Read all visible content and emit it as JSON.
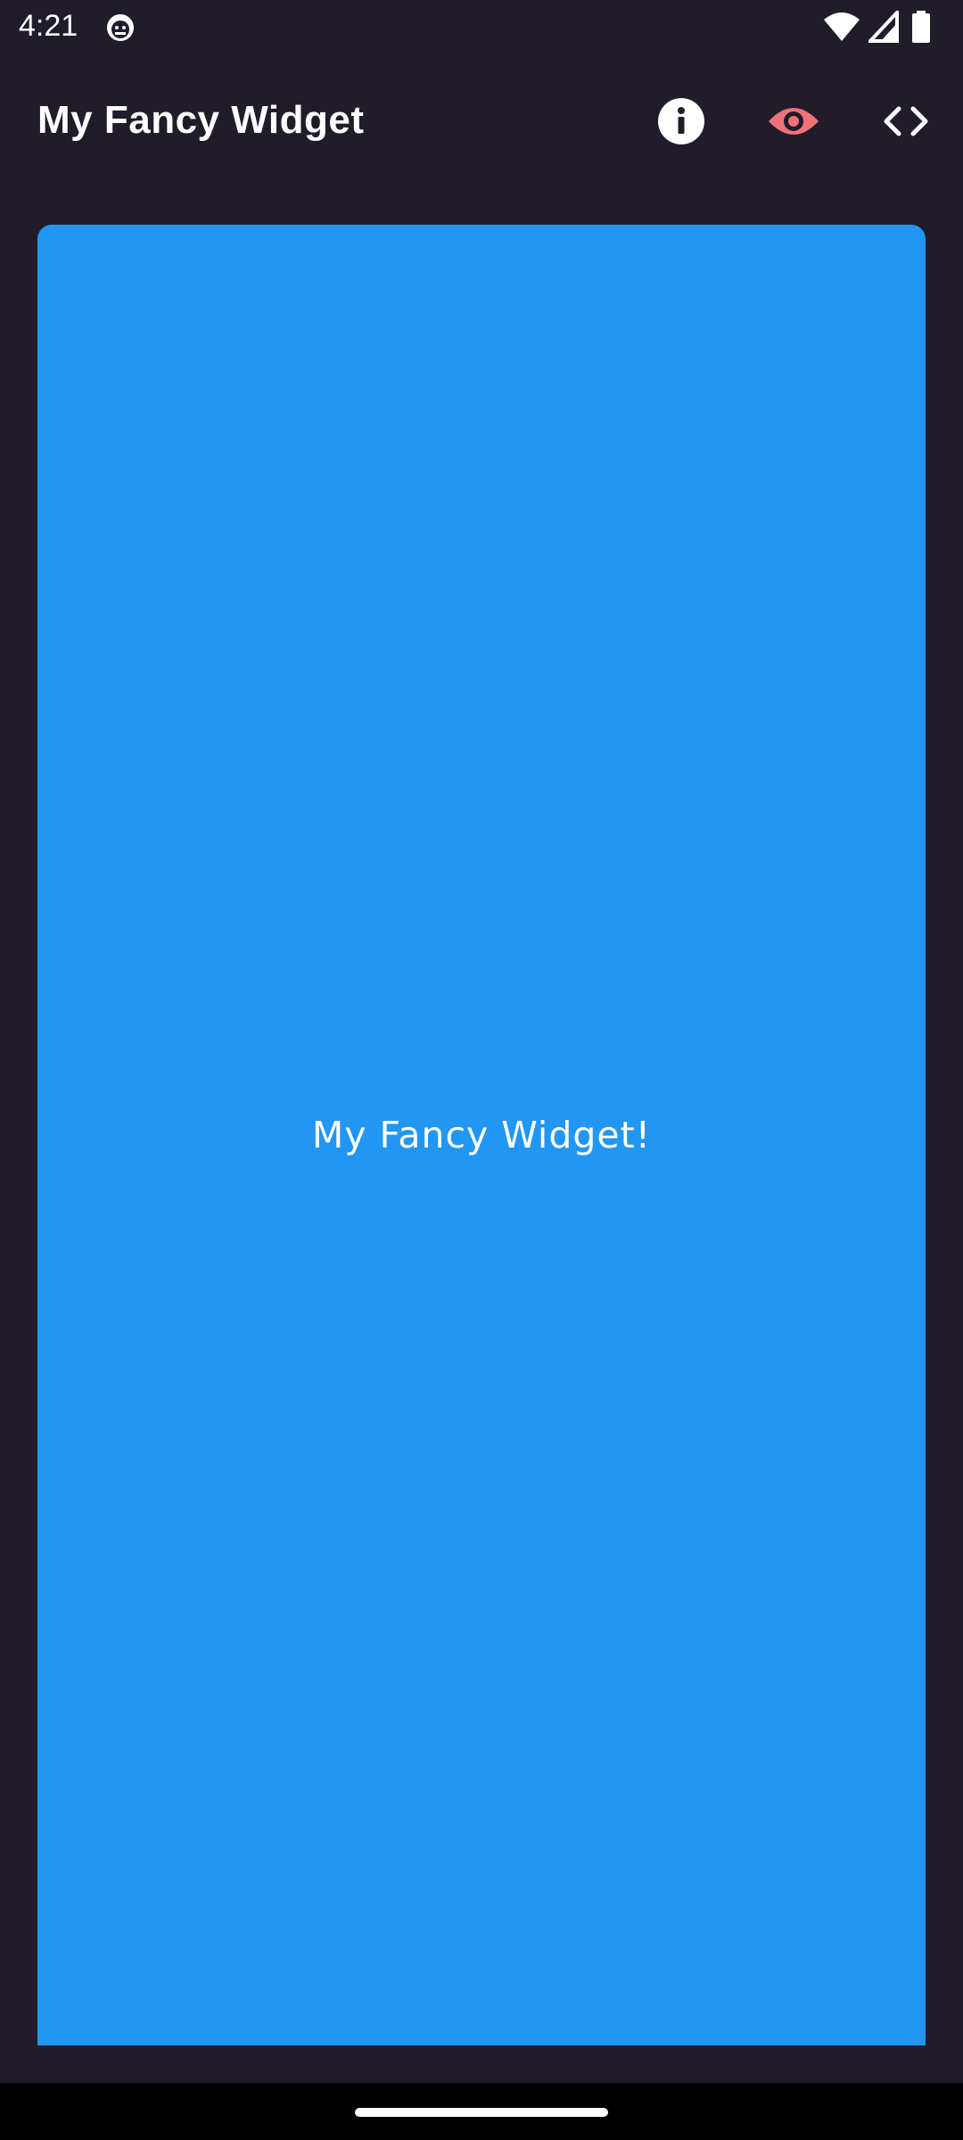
{
  "status_bar": {
    "time": "4:21",
    "app_icon": "android-debug-icon",
    "icons": [
      "wifi-icon",
      "signal-icon",
      "battery-icon"
    ]
  },
  "app_bar": {
    "title": "My Fancy Widget",
    "actions": [
      {
        "name": "info",
        "icon": "info-icon",
        "color": "#ffffff"
      },
      {
        "name": "preview",
        "icon": "eye-icon",
        "color": "#f07178"
      },
      {
        "name": "code",
        "icon": "code-icon",
        "color": "#ffffff"
      }
    ]
  },
  "widget": {
    "text": "My Fancy Widget!",
    "background": "#2196f3"
  },
  "colors": {
    "background": "#201c2a",
    "accent": "#f07178"
  }
}
